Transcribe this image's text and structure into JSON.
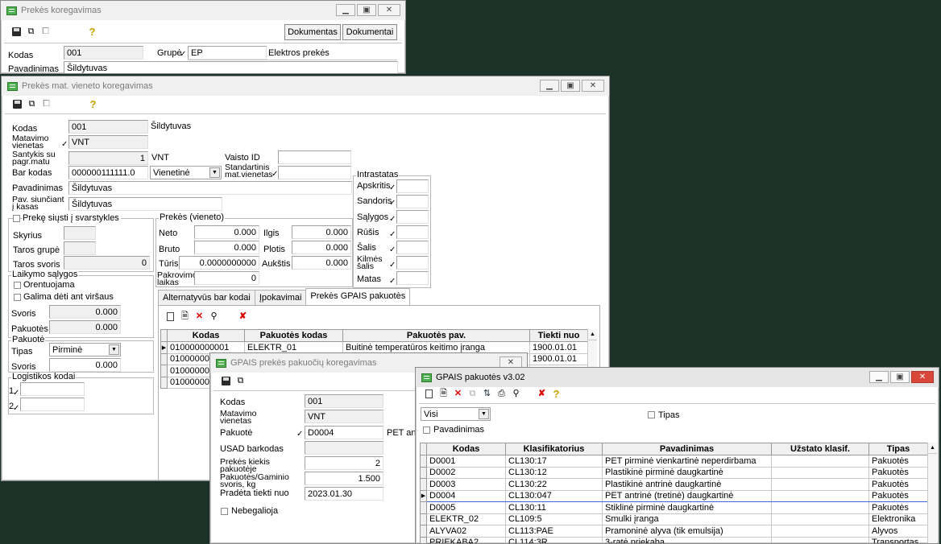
{
  "w1": {
    "title": "Prekės koregavimas",
    "btn_dokumentas": "Dokumentas",
    "btn_dokumentai": "Dokumentai",
    "kodas_label": "Kodas",
    "kodas_value": "001",
    "grupe_label": "Grupė",
    "grupe_value": "EP",
    "grupe_name": "Elektros prekės",
    "pavadinimas_label": "Pavadinimas",
    "pavadinimas_value": "Šildytuvas"
  },
  "w2": {
    "title": "Prekės mat. vieneto koregavimas",
    "kodas_label": "Kodas",
    "kodas_value": "001",
    "kodas_name": "Šildytuvas",
    "matavimo_label_1": "Matavimo",
    "matavimo_label_2": "vienetas",
    "matavimo_value": "VNT",
    "santykis_label_1": "Santykis su",
    "santykis_label_2": "pagr.matu",
    "santykis_value": "1",
    "santykis_unit": "VNT",
    "vaisto_label": "Vaisto ID",
    "barkodas_label": "Bar kodas",
    "barkodas_value": "000000111111.0",
    "barkodas_type": "Vienetinė",
    "standartinis_label_1": "Standartinis",
    "standartinis_label_2": "mat.vienetas",
    "pavadinimas_label": "Pavadinimas",
    "pavadinimas_value": "Šildytuvas",
    "pavsiunciant_label_1": "Pav. siunčiant",
    "pavsiunciant_label_2": "į kasas",
    "pavsiunciant_value": "Šildytuvas",
    "intrastatas": {
      "caption": "Intrastatas",
      "rows": [
        {
          "label": "Apskritis"
        },
        {
          "label": "Sandoris"
        },
        {
          "label": "Sąlygos"
        },
        {
          "label": "Rūšis"
        },
        {
          "label": "Šalis"
        },
        {
          "label": "Kilmės šalis"
        },
        {
          "label": "Matas"
        }
      ]
    },
    "svarstykles_label": "Prekę siųsti į svarstykles",
    "skyrius_label": "Skyrius",
    "taros_grupe_label": "Taros grupė",
    "taros_svoris_label": "Taros svoris",
    "taros_svoris_value": "0",
    "prekes_vieneto_caption": "Prekės (vieneto)",
    "neto_label": "Neto",
    "neto_value": "0.000",
    "bruto_label": "Bruto",
    "bruto_value": "0.000",
    "turis_label": "Tūris",
    "turis_value": "0.0000000000",
    "pakrovimo_label_1": "Pakrovimo",
    "pakrovimo_label_2": "laikas",
    "pakrovimo_value": "0",
    "ilgis_label": "Ilgis",
    "ilgis_value": "0.000",
    "plotis_label": "Plotis",
    "plotis_value": "0.000",
    "auktis_label": "Aukštis",
    "auktis_value": "0.000",
    "laikymo_caption": "Laikymo sąlygos",
    "orentuojama_label": "Orentuojama",
    "galima_label": "Galima dėti ant viršaus",
    "svoris_label": "Svoris",
    "svoris_value": "0.000",
    "pakuotes_label": "Pakuotės",
    "pakuotes_value": "0.000",
    "pakuote_caption": "Pakuotė",
    "tipas_label": "Tipas",
    "tipas_value": "Pirminė",
    "pakuote_svoris_label": "Svoris",
    "pakuote_svoris_value": "0.000",
    "logistikos_caption": "Logistikos kodai",
    "log1": "1",
    "log2": "2",
    "tabs": [
      "Alternatyvūs bar kodai",
      "Įpokavimai",
      "Prekės GPAIS pakuotės"
    ],
    "grid": {
      "headers": [
        "Kodas",
        "Pakuotės kodas",
        "Pakuotės pav.",
        "Tiekti nuo"
      ],
      "rows": [
        {
          "kodas": "010000000001",
          "pak_kodas": "ELEKTR_01",
          "pak_pav": "Buitinė temperatūros keitimo įranga",
          "tiekti": "1900.01.01"
        },
        {
          "kodas": "010000000",
          "pak_kodas": "",
          "pak_pav": "",
          "tiekti": "1900.01.01"
        },
        {
          "kodas": "010000000",
          "pak_kodas": "",
          "pak_pav": "",
          "tiekti": ""
        },
        {
          "kodas": "010000000",
          "pak_kodas": "",
          "pak_pav": "",
          "tiekti": ""
        }
      ]
    }
  },
  "w3": {
    "title": "GPAIS prekės pakuočių koregavimas",
    "kodas_label": "Kodas",
    "kodas_value": "001",
    "matavimo_label_1": "Matavimo",
    "matavimo_label_2": "vienetas",
    "matavimo_value": "VNT",
    "pakuote_label": "Pakuotė",
    "pakuote_value": "D0004",
    "pakuote_name": "PET antri",
    "usad_label": "USAD barkodas",
    "kiekis_label_1": "Prekės kiekis",
    "kiekis_label_2": "pakuotėje",
    "kiekis_value": "2",
    "svoris_label_1": "Pakuotės/Gaminio",
    "svoris_label_2": "svoris, kg",
    "svoris_value": "1.500",
    "pradeta_label": "Pradėta tiekti nuo",
    "pradeta_value": "2023.01.30",
    "nebegalioja_label": "Nebegalioja"
  },
  "w4": {
    "title": "GPAIS pakuotės v3.02",
    "filter_value": "Visi",
    "tipas_label": "Tipas",
    "pavadinimas_label": "Pavadinimas",
    "headers": [
      "Kodas",
      "Klasifikatorius",
      "Pavadinimas",
      "Užstato klasif.",
      "Tipas"
    ],
    "rows": [
      {
        "kodas": "D0001",
        "klas": "CL130:17",
        "pav": "PET pirminė vienkartinė neperdirbama",
        "uzst": "",
        "tipas": "Pakuotės"
      },
      {
        "kodas": "D0002",
        "klas": "CL130:12",
        "pav": "Plastikinė pirminė daugkartinė",
        "uzst": "",
        "tipas": "Pakuotės"
      },
      {
        "kodas": "D0003",
        "klas": "CL130:22",
        "pav": "Plastikinė antrinė daugkartinė",
        "uzst": "",
        "tipas": "Pakuotės"
      },
      {
        "kodas": "D0004",
        "klas": "CL130:047",
        "pav": "PET antrinė (tretinė) daugkartinė",
        "uzst": "",
        "tipas": "Pakuotės"
      },
      {
        "kodas": "D0005",
        "klas": "CL130:11",
        "pav": "Stiklinė pirminė daugkartinė",
        "uzst": "",
        "tipas": "Pakuotės"
      },
      {
        "kodas": "ELEKTR_02",
        "klas": "CL109:5",
        "pav": "Smulki įranga",
        "uzst": "",
        "tipas": "Elektronika"
      },
      {
        "kodas": "ALYVA02",
        "klas": "CL113:PAE",
        "pav": "Pramoninė alyva (tik emulsija)",
        "uzst": "",
        "tipas": "Alyvos"
      },
      {
        "kodas": "PRIEKABA2",
        "klas": "CL114:3R",
        "pav": "3-ratė priekaba",
        "uzst": "",
        "tipas": "Transportas"
      }
    ]
  }
}
